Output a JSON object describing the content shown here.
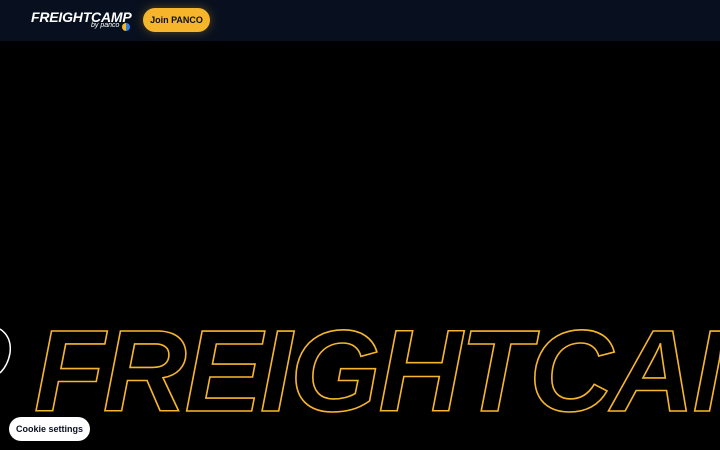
{
  "header": {
    "logo_text": "FREIGHTCAMP",
    "logo_sub": "by panco",
    "join_button": "Join PANCO"
  },
  "hero": {
    "outline_text": "FREIGHTCAMP"
  },
  "cookie": {
    "button_label": "Cookie settings"
  },
  "colors": {
    "accent": "#f7b52c",
    "header_bg": "#08101f",
    "page_bg": "#000000",
    "secondary_dot": "#2f7fe0"
  }
}
